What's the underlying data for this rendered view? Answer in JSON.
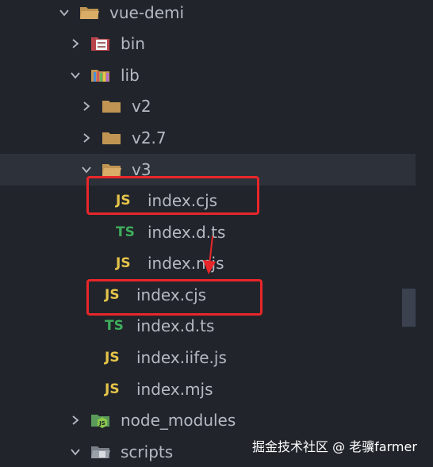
{
  "tree": [
    {
      "label": "vue-demi",
      "kind": "folder",
      "expanded": true
    },
    {
      "label": "bin",
      "kind": "bin",
      "expanded": false
    },
    {
      "label": "lib",
      "kind": "lib",
      "expanded": true
    },
    {
      "label": "v2",
      "kind": "folder",
      "expanded": false
    },
    {
      "label": "v2.7",
      "kind": "folder",
      "expanded": false
    },
    {
      "label": "v3",
      "kind": "folder",
      "expanded": true
    },
    {
      "label": "index.cjs",
      "badge": "JS"
    },
    {
      "label": "index.d.ts",
      "badge": "TS"
    },
    {
      "label": "index.mjs",
      "badge": "JS"
    },
    {
      "label": "index.cjs",
      "badge": "JS"
    },
    {
      "label": "index.d.ts",
      "badge": "TS"
    },
    {
      "label": "index.iife.js",
      "badge": "JS"
    },
    {
      "label": "index.mjs",
      "badge": "JS"
    },
    {
      "label": "node_modules",
      "kind": "node",
      "expanded": false
    },
    {
      "label": "scripts",
      "kind": "scripts",
      "expanded": true
    }
  ],
  "watermark": "掘金技术社区 @ 老骥farmer",
  "colors": {
    "background": "#21252b",
    "selected_row": "#2c313a",
    "highlight": "#e8262a",
    "js": "#e5c44a",
    "ts": "#3fae5c",
    "folder": "#c09553"
  }
}
